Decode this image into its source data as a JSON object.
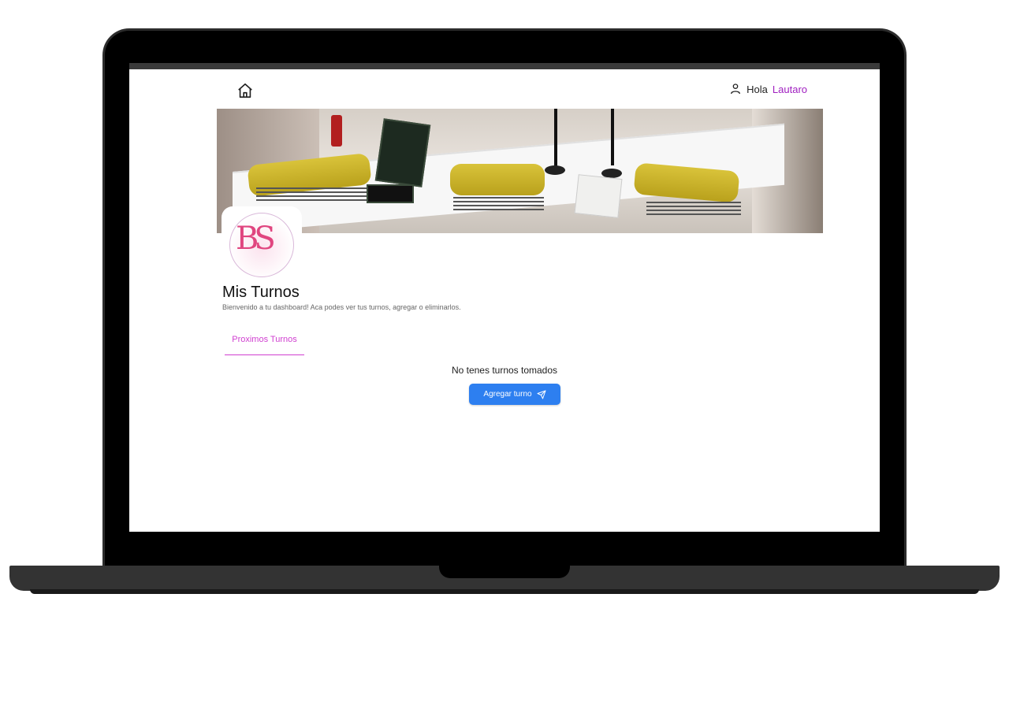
{
  "header": {
    "greeting": "Hola",
    "user_name": "Lautaro"
  },
  "page": {
    "title": "Mis Turnos",
    "subtitle": "Bienvenido a tu dashboard! Aca podes ver tus turnos, agregar o eliminarlos."
  },
  "tabs": [
    {
      "label": "Proximos Turnos",
      "active": true
    }
  ],
  "empty_state": {
    "message": "No tenes turnos tomados",
    "button_label": "Agregar turno"
  },
  "colors": {
    "accent_pink": "#d03fd0",
    "user_name": "#a020c0",
    "button_blue": "#2d7ff0"
  },
  "icons": {
    "home": "home-icon",
    "user": "user-icon",
    "send": "send-icon"
  }
}
